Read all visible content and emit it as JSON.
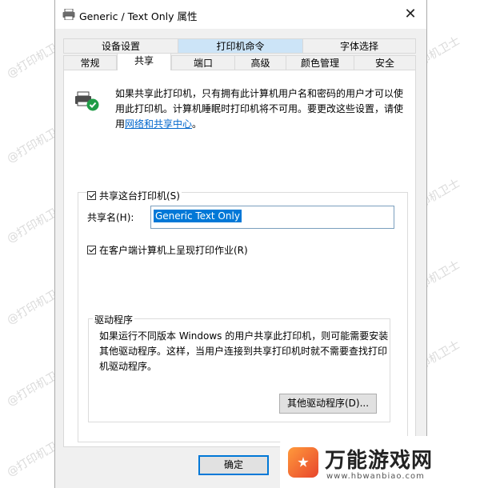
{
  "window": {
    "title": "Generic / Text Only 属性",
    "close_icon": "close-icon"
  },
  "tabs": {
    "row_top": [
      "设备设置",
      "打印机命令",
      "字体选择"
    ],
    "row_bottom": [
      "常规",
      "共享",
      "端口",
      "高级",
      "颜色管理",
      "安全"
    ],
    "active": "共享",
    "highlighted": "打印机命令"
  },
  "sharing": {
    "description_prefix": "如果共享此打印机，只有拥有此计算机用户名和密码的用户才可以使用此打印机。计算机睡眠时打印机将不可用。要更改这些设置，请使用",
    "link_text": "网络和共享中心",
    "description_suffix": "。",
    "share_checkbox_label": "共享这台打印机(S)",
    "share_checkbox_checked": true,
    "share_name_label": "共享名(H):",
    "share_name_value": "Generic  Text Only",
    "render_checkbox_label": "在客户端计算机上呈现打印作业(R)",
    "render_checkbox_checked": true
  },
  "drivers": {
    "group_title": "驱动程序",
    "text": "如果运行不同版本 Windows 的用户共享此打印机，则可能需要安装其他驱动程序。这样，当用户连接到共享打印机时就不需要查找打印机驱动程序。",
    "button_label": "其他驱动程序(D)..."
  },
  "footer": {
    "ok_label": "确定"
  },
  "watermark_text": "@打印机卫士",
  "brand": {
    "name": "万能游戏网",
    "url": "www.hbwanbiao.com"
  },
  "colors": {
    "accent": "#0078d7",
    "link": "#0066cc",
    "tab_highlight": "#cce4f7"
  }
}
